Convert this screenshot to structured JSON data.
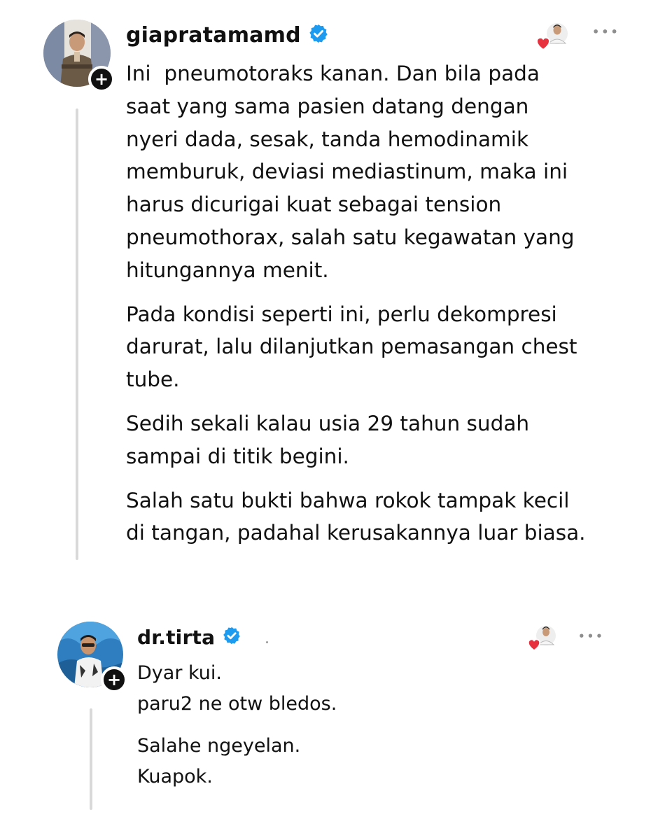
{
  "colors": {
    "text": "#111111",
    "verified": "#1d9bf0",
    "heart": "#e8313f",
    "muted": "#8e8e8e",
    "thread_line": "#d9d9d9"
  },
  "posts": [
    {
      "username": "giapratamamd",
      "verified": true,
      "avatar_icon": "profile-photo",
      "more_label": "•••",
      "paragraphs": [
        "Ini  pneumotoraks kanan. Dan bila pada\nsaat yang sama pasien datang dengan\nnyeri dada, sesak, tanda hemodinamik\nmemburuk, deviasi mediastinum, maka ini\nharus dicurigai kuat sebagai tension\npneumothorax, salah satu kegawatan yang\nhitungannya menit.",
        "Pada kondisi seperti ini, perlu dekompresi\ndarurat, lalu dilanjutkan pemasangan chest\ntube.",
        "Sedih sekali kalau usia 29 tahun sudah\nsampai di titik begini.",
        "Salah satu bukti bahwa rokok tampak kecil\ndi tangan, padahal kerusakannya luar biasa."
      ]
    },
    {
      "username": "dr.tirta",
      "verified": true,
      "avatar_icon": "profile-photo",
      "more_label": "•••",
      "paragraphs": [
        "Dyar kui.\nparu2 ne otw bledos.",
        "Salahe ngeyelan.\nKuapok."
      ]
    }
  ]
}
